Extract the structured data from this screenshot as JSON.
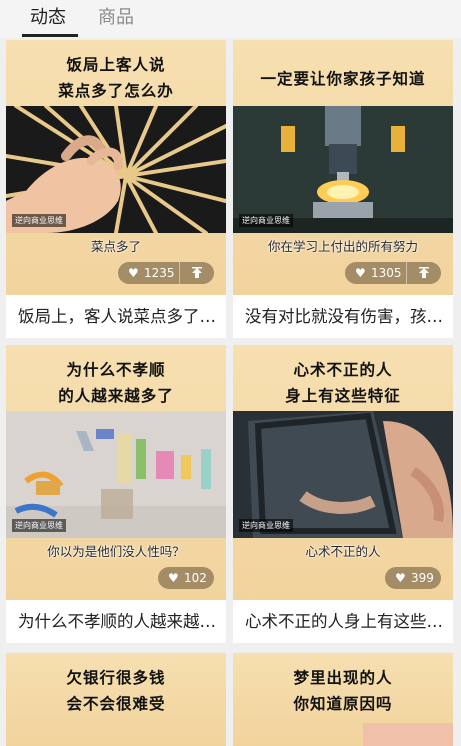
{
  "tabs": {
    "dynamics": "动态",
    "products": "商品"
  },
  "cards": [
    {
      "headline": [
        "饭局上客人说",
        "菜点多了怎么办"
      ],
      "caption": "菜点多了",
      "likes": "1235",
      "title": "饭局上，客人说菜点多了怎么办",
      "watermark": "逆向商业思维"
    },
    {
      "headline": [
        "一定要让你家孩子知道"
      ],
      "caption": "你在学习上付出的所有努力",
      "likes": "1305",
      "title": "没有对比就没有伤害，孩子一定要知道",
      "watermark": "逆向商业思维"
    },
    {
      "headline": [
        "为什么不孝顺",
        "的人越来越多了"
      ],
      "caption": "你以为是他们没人性吗？",
      "likes": "102",
      "title": "为什么不孝顺的人越来越多了",
      "watermark": "逆向商业思维"
    },
    {
      "headline": [
        "心术不正的人",
        "身上有这些特征"
      ],
      "caption": "心术不正的人",
      "likes": "399",
      "title": "心术不正的人身上有这些特征",
      "watermark": "逆向商业思维"
    },
    {
      "headline": [
        "欠银行很多钱",
        "会不会很难受"
      ]
    },
    {
      "headline": [
        "梦里出现的人",
        "你知道原因吗"
      ]
    }
  ],
  "icons": {
    "like": "heart-icon",
    "share": "share-up-icon"
  }
}
